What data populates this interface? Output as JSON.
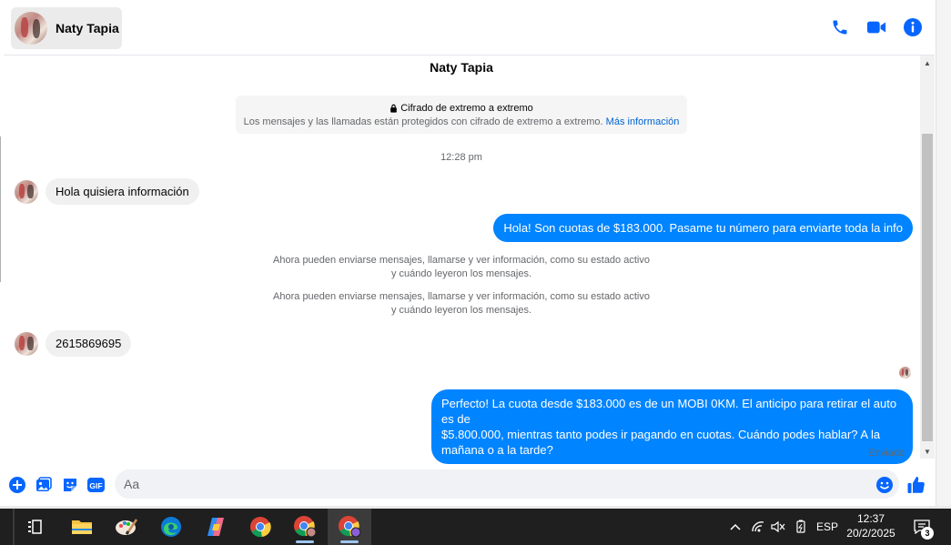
{
  "header": {
    "contact_name": "Naty Tapia",
    "icons": [
      "phone-icon",
      "video-camera-icon",
      "info-icon"
    ]
  },
  "thread": {
    "title": "Naty Tapia",
    "encryption": {
      "title": "Cifrado de extremo a extremo",
      "body": "Los mensajes y las llamadas están protegidos con cifrado de extremo a extremo.",
      "link": "Más información"
    },
    "timestamp": "12:28 pm",
    "messages": [
      {
        "direction": "in",
        "text": "Hola quisiera información"
      },
      {
        "direction": "out",
        "text": "Hola! Son cuotas de $183.000. Pasame tu número para enviarte toda la info"
      },
      {
        "direction": "system",
        "line1": "Ahora pueden enviarse mensajes, llamarse y ver información, como su estado activo",
        "line2": "y cuándo leyeron los mensajes."
      },
      {
        "direction": "system",
        "line1": "Ahora pueden enviarse mensajes, llamarse y ver información, como su estado activo",
        "line2": "y cuándo leyeron los mensajes."
      },
      {
        "direction": "in",
        "text": "2615869695"
      },
      {
        "direction": "out",
        "line1": "Perfecto! La cuota desde $183.000 es de un MOBI 0KM. El anticipo para retirar el auto es de",
        "line2": "$5.800.000, mientras tanto podes ir pagando en cuotas. Cuándo podes hablar? A la",
        "line3": "mañana o a la tarde?"
      }
    ],
    "status": "Enviado"
  },
  "composer": {
    "placeholder": "Aa",
    "value": "",
    "icons": [
      "plus-circle-icon",
      "image-icon",
      "sticker-icon",
      "gif-icon",
      "emoji-icon",
      "thumbs-up-icon"
    ],
    "gif_label": "GIF"
  },
  "taskbar": {
    "apps": [
      "task-view-icon",
      "file-explorer-icon",
      "paint-icon",
      "edge-icon",
      "copilot-icon",
      "chrome-icon",
      "chrome-profile-icon",
      "chrome-profile-active-icon"
    ],
    "language": "ESP",
    "time": "12:37",
    "date": "20/2/2025",
    "notification_count": "3"
  },
  "colors": {
    "accent": "#0084ff",
    "icon_blue": "#0866ff",
    "incoming_bubble": "#f0f0f0",
    "taskbar": "#1f1f1f"
  }
}
